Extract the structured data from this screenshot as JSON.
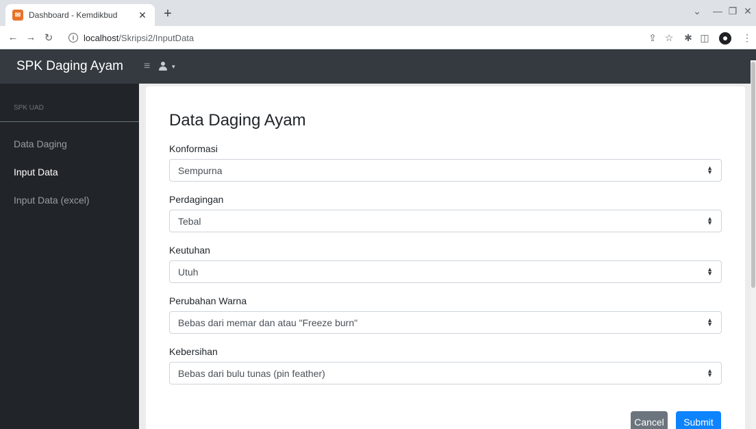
{
  "browser": {
    "tab_title": "Dashboard - Kemdikbud",
    "url_host": "localhost",
    "url_path": "/Skripsi2/InputData"
  },
  "navbar": {
    "brand": "SPK Daging Ayam"
  },
  "sidebar": {
    "heading": "SPK UAD",
    "items": [
      {
        "label": "Data Daging",
        "active": false
      },
      {
        "label": "Input Data",
        "active": true
      },
      {
        "label": "Input Data (excel)",
        "active": false
      }
    ]
  },
  "form": {
    "title": "Data Daging Ayam",
    "fields": [
      {
        "label": "Konformasi",
        "value": "Sempurna"
      },
      {
        "label": "Perdagingan",
        "value": "Tebal"
      },
      {
        "label": "Keutuhan",
        "value": "Utuh"
      },
      {
        "label": "Perubahan Warna",
        "value": "Bebas dari memar dan atau \"Freeze burn\""
      },
      {
        "label": "Kebersihan",
        "value": "Bebas dari bulu tunas (pin feather)"
      }
    ],
    "cancel_label": "Cancel",
    "submit_label": "Submit"
  },
  "colors": {
    "navbar_bg": "#343a40",
    "sidebar_bg": "#212529",
    "submit_bg": "#0d83fd",
    "cancel_bg": "#6c757d"
  },
  "icons": [
    "info-icon",
    "back-icon",
    "forward-icon",
    "reload-icon",
    "share-icon",
    "star-icon",
    "extensions-icon",
    "sidepanel-icon",
    "profile-icon",
    "hamburger-icon",
    "user-icon",
    "select-arrow-icon"
  ]
}
